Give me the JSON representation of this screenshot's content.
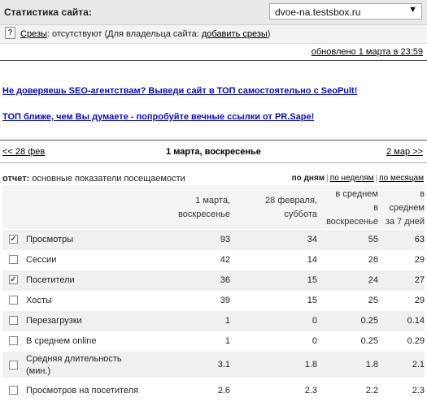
{
  "header": {
    "title": "Статистика сайта:",
    "site": "dvoe-na.testsbox.ru"
  },
  "slices": {
    "label": "Срезы",
    "text": ": отсутствуют (Для владельца сайта: ",
    "add_link": "добавить срезы",
    "suffix": ")"
  },
  "updated": "обновлено 1 марта в 23:59",
  "ads": [
    "Не доверяешь SEO-агентствам? Выведи сайт в ТОП самостоятельно с SeoPult!",
    "ТОП ближе, чем Вы думаете - попробуйте вечные ссылки от PR.Sape!"
  ],
  "nav": {
    "prev": "<< 28 фев",
    "current": "1 марта, воскресенье",
    "next": "2 мар >>"
  },
  "report": {
    "label": "отчет:",
    "title": "основные показатели посещаемости"
  },
  "views": {
    "days": "по дням",
    "weeks": "по неделям",
    "months": "по месяцам"
  },
  "table": {
    "columns": [
      [
        "1 марта,",
        "воскресенье"
      ],
      [
        "28 февраля,",
        "суббота"
      ],
      [
        "в среднем",
        "в",
        "воскресенье"
      ],
      [
        "в",
        "среднем",
        "за 7 дней"
      ]
    ],
    "rows": [
      {
        "label": "Просмотры",
        "checked": true,
        "values": [
          "93",
          "34",
          "55",
          "63"
        ]
      },
      {
        "label": "Сессии",
        "checked": false,
        "values": [
          "42",
          "14",
          "26",
          "29"
        ]
      },
      {
        "label": "Посетители",
        "checked": true,
        "values": [
          "36",
          "15",
          "24",
          "27"
        ]
      },
      {
        "label": "Хосты",
        "checked": false,
        "values": [
          "39",
          "15",
          "25",
          "29"
        ]
      },
      {
        "label": "Перезагрузки",
        "checked": false,
        "values": [
          "1",
          "0",
          "0.25",
          "0.14"
        ]
      },
      {
        "label": "В среднем online",
        "checked": false,
        "values": [
          "1",
          "0",
          "0.25",
          "0.29"
        ]
      },
      {
        "label": "Средняя длительность (мин.)",
        "checked": false,
        "values": [
          "3.1",
          "1.8",
          "1.8",
          "2.1"
        ]
      },
      {
        "label": "Просмотров на посетителя",
        "checked": false,
        "values": [
          "2.6",
          "2.3",
          "2.2",
          "2.3"
        ]
      }
    ]
  }
}
